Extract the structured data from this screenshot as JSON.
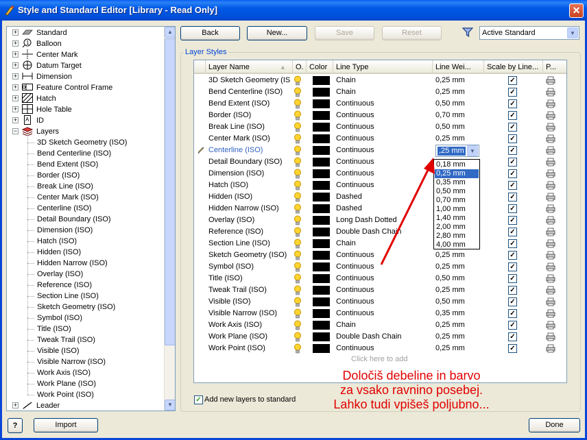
{
  "window": {
    "title": "Style and Standard Editor [Library - Read Only]",
    "close": "✕"
  },
  "tree": {
    "top_items": [
      {
        "label": "Standard",
        "icon": "standard-icon"
      },
      {
        "label": "Balloon",
        "icon": "balloon-icon"
      },
      {
        "label": "Center Mark",
        "icon": "center-mark-icon"
      },
      {
        "label": "Datum Target",
        "icon": "datum-target-icon"
      },
      {
        "label": "Dimension",
        "icon": "dimension-icon"
      },
      {
        "label": "Feature Control Frame",
        "icon": "feature-control-frame-icon"
      },
      {
        "label": "Hatch",
        "icon": "hatch-icon"
      },
      {
        "label": "Hole Table",
        "icon": "hole-table-icon"
      },
      {
        "label": "ID",
        "icon": "id-icon"
      },
      {
        "label": "Layers",
        "icon": "layers-icon"
      }
    ],
    "layer_children": [
      "3D Sketch Geometry (ISO)",
      "Bend Centerline (ISO)",
      "Bend Extent (ISO)",
      "Border (ISO)",
      "Break Line (ISO)",
      "Center Mark (ISO)",
      "Centerline (ISO)",
      "Detail Boundary (ISO)",
      "Dimension (ISO)",
      "Hatch (ISO)",
      "Hidden (ISO)",
      "Hidden Narrow (ISO)",
      "Overlay (ISO)",
      "Reference (ISO)",
      "Section Line (ISO)",
      "Sketch Geometry (ISO)",
      "Symbol (ISO)",
      "Title (ISO)",
      "Tweak Trail (ISO)",
      "Visible (ISO)",
      "Visible Narrow (ISO)",
      "Work Axis (ISO)",
      "Work Plane (ISO)",
      "Work Point (ISO)"
    ],
    "last_item": {
      "label": "Leader",
      "icon": "leader-icon"
    }
  },
  "toolbar": {
    "back": "Back",
    "new": "New...",
    "save": "Save",
    "reset": "Reset",
    "filter_icon": "filter-icon",
    "standard_select": "Active Standard"
  },
  "group_title": "Layer Styles",
  "grid": {
    "headers": [
      "Layer Name",
      "O.",
      "Color",
      "Line Type",
      "Line Wei...",
      "Scale by Line...",
      "P..."
    ],
    "sort_indicator": "▲",
    "rows": [
      {
        "name": "3D Sketch Geometry (IS",
        "line_type": "Chain",
        "weight": "0,25 mm"
      },
      {
        "name": "Bend Centerline (ISO)",
        "line_type": "Chain",
        "weight": "0,25 mm"
      },
      {
        "name": "Bend Extent (ISO)",
        "line_type": "Continuous",
        "weight": "0,50 mm"
      },
      {
        "name": "Border (ISO)",
        "line_type": "Continuous",
        "weight": "0,70 mm"
      },
      {
        "name": "Break Line (ISO)",
        "line_type": "Continuous",
        "weight": "0,50 mm"
      },
      {
        "name": "Center Mark (ISO)",
        "line_type": "Continuous",
        "weight": "0,25 mm"
      },
      {
        "name": "Centerline (ISO)",
        "line_type": "Continuous",
        "weight": "",
        "editing": true
      },
      {
        "name": "Detail Boundary (ISO)",
        "line_type": "Continuous",
        "weight": ""
      },
      {
        "name": "Dimension (ISO)",
        "line_type": "Continuous",
        "weight": ""
      },
      {
        "name": "Hatch (ISO)",
        "line_type": "Continuous",
        "weight": ""
      },
      {
        "name": "Hidden (ISO)",
        "line_type": "Dashed",
        "weight": ""
      },
      {
        "name": "Hidden Narrow (ISO)",
        "line_type": "Dashed",
        "weight": ""
      },
      {
        "name": "Overlay (ISO)",
        "line_type": "Long Dash Dotted",
        "weight": ""
      },
      {
        "name": "Reference (ISO)",
        "line_type": "Double Dash Chain",
        "weight": ""
      },
      {
        "name": "Section Line (ISO)",
        "line_type": "Chain",
        "weight": ""
      },
      {
        "name": "Sketch Geometry (ISO)",
        "line_type": "Continuous",
        "weight": "0,25 mm"
      },
      {
        "name": "Symbol (ISO)",
        "line_type": "Continuous",
        "weight": "0,25 mm"
      },
      {
        "name": "Title (ISO)",
        "line_type": "Continuous",
        "weight": "0,50 mm"
      },
      {
        "name": "Tweak Trail (ISO)",
        "line_type": "Continuous",
        "weight": "0,25 mm"
      },
      {
        "name": "Visible (ISO)",
        "line_type": "Continuous",
        "weight": "0,50 mm"
      },
      {
        "name": "Visible Narrow (ISO)",
        "line_type": "Continuous",
        "weight": "0,35 mm"
      },
      {
        "name": "Work Axis (ISO)",
        "line_type": "Chain",
        "weight": "0,25 mm"
      },
      {
        "name": "Work Plane (ISO)",
        "line_type": "Double Dash Chain",
        "weight": "0,25 mm"
      },
      {
        "name": "Work Point (ISO)",
        "line_type": "Continuous",
        "weight": "0,25 mm"
      }
    ],
    "add_row": "Click here to add",
    "edit_value": ",25 mm",
    "dropdown_options": [
      "0,18 mm",
      "0,25 mm",
      "0,35 mm",
      "0,50 mm",
      "0,70 mm",
      "1,00 mm",
      "1,40 mm",
      "2,00 mm",
      "2,80 mm",
      "4,00 mm"
    ],
    "dropdown_selected": "0,25 mm"
  },
  "add_new_layers": "Add new layers to standard",
  "annotation": {
    "lines": [
      "Določiš debeline in barvo",
      "za vsako ravnino posebej.",
      "Lahko tudi vpišeš poljubno..."
    ],
    "color": "#e10000"
  },
  "footer": {
    "help": "?",
    "import": "Import",
    "done": "Done"
  }
}
